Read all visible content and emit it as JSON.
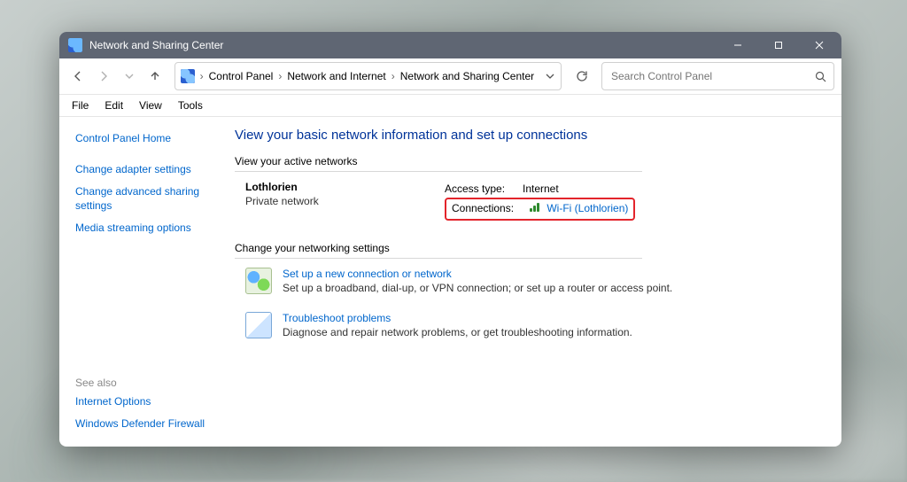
{
  "titlebar": {
    "title": "Network and Sharing Center"
  },
  "breadcrumb": {
    "root": "Control Panel",
    "mid": "Network and Internet",
    "leaf": "Network and Sharing Center"
  },
  "search": {
    "placeholder": "Search Control Panel"
  },
  "menu": {
    "file": "File",
    "edit": "Edit",
    "view": "View",
    "tools": "Tools"
  },
  "sidebar": {
    "home": "Control Panel Home",
    "adapter": "Change adapter settings",
    "advanced": "Change advanced sharing settings",
    "media": "Media streaming options",
    "see_also": "See also",
    "inet": "Internet Options",
    "fw": "Windows Defender Firewall"
  },
  "main": {
    "heading": "View your basic network information and set up connections",
    "active_label": "View your active networks",
    "network_name": "Lothlorien",
    "network_type": "Private network",
    "access_label": "Access type:",
    "access_value": "Internet",
    "conn_label": "Connections:",
    "conn_value": "Wi-Fi (Lothlorien)",
    "change_label": "Change your networking settings",
    "task1_title": "Set up a new connection or network",
    "task1_desc": "Set up a broadband, dial-up, or VPN connection; or set up a router or access point.",
    "task2_title": "Troubleshoot problems",
    "task2_desc": "Diagnose and repair network problems, or get troubleshooting information."
  }
}
